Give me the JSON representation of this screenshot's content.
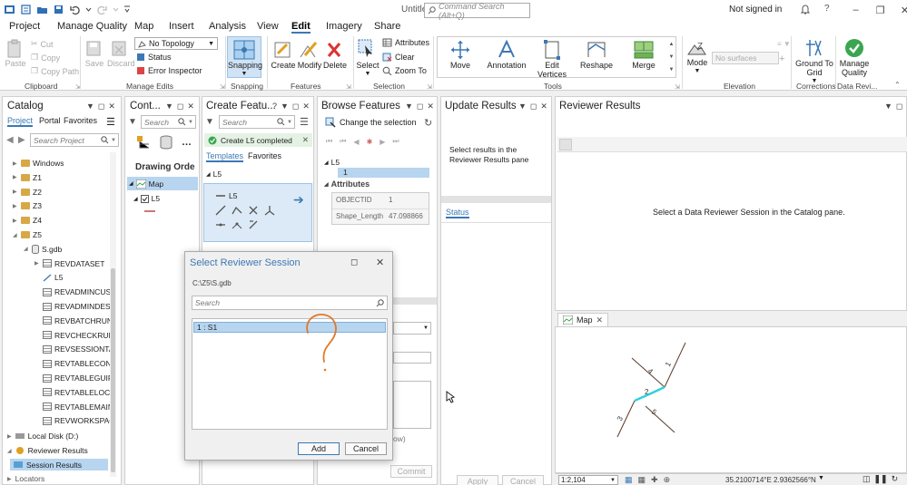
{
  "titlebar": {
    "doc_title": "Untitled",
    "command_search_placeholder": "Command Search (Alt+Q)",
    "signed_in": "Not signed in"
  },
  "menu": {
    "tabs": [
      "Project",
      "Manage Quality",
      "Map",
      "Insert",
      "Analysis",
      "View",
      "Edit",
      "Imagery",
      "Share"
    ],
    "active": "Edit"
  },
  "ribbon": {
    "clipboard": {
      "paste": "Paste",
      "cut": "Cut",
      "copy": "Copy",
      "copy_path": "Copy Path",
      "label": "Clipboard"
    },
    "manage_edits": {
      "save": "Save",
      "discard": "Discard",
      "topology": "No Topology",
      "status": "Status",
      "error_inspector": "Error Inspector",
      "label": "Manage Edits"
    },
    "snapping": {
      "snapping": "Snapping",
      "label": "Snapping"
    },
    "features": {
      "create": "Create",
      "modify": "Modify",
      "delete": "Delete",
      "label": "Features"
    },
    "selection": {
      "select": "Select",
      "attributes": "Attributes",
      "clear": "Clear",
      "zoom_to": "Zoom To",
      "label": "Selection"
    },
    "tools": {
      "move": "Move",
      "annotation": "Annotation",
      "edit_vertices": "Edit Vertices",
      "reshape": "Reshape",
      "merge": "Merge",
      "label": "Tools"
    },
    "elevation": {
      "mode": "Mode",
      "surfaces": "No surfaces",
      "label": "Elevation"
    },
    "corrections": {
      "ground_to_grid": "Ground To Grid",
      "label": "Corrections"
    },
    "data_reviewer": {
      "manage_quality": "Manage Quality",
      "label": "Data Revi..."
    }
  },
  "catalog": {
    "title": "Catalog",
    "tabs": [
      "Project",
      "Portal",
      "Favorites"
    ],
    "search_placeholder": "Search Project",
    "items": [
      {
        "label": "Windows",
        "type": "folder",
        "indent": 0
      },
      {
        "label": "Z1",
        "type": "folder",
        "indent": 0
      },
      {
        "label": "Z2",
        "type": "folder",
        "indent": 0
      },
      {
        "label": "Z3",
        "type": "folder",
        "indent": 0
      },
      {
        "label": "Z4",
        "type": "folder",
        "indent": 0
      },
      {
        "label": "Z5",
        "type": "folder",
        "indent": 0
      },
      {
        "label": "S.gdb",
        "type": "gdb",
        "indent": 1
      },
      {
        "label": "REVDATASET",
        "type": "dataset",
        "indent": 2
      },
      {
        "label": "L5",
        "type": "line",
        "indent": 2
      },
      {
        "label": "REVADMINCUST",
        "type": "table",
        "indent": 2
      },
      {
        "label": "REVADMINDESC",
        "type": "table",
        "indent": 2
      },
      {
        "label": "REVBATCHRUNT",
        "type": "table",
        "indent": 2
      },
      {
        "label": "REVCHECKRUNT",
        "type": "table",
        "indent": 2
      },
      {
        "label": "REVSESSIONTAE",
        "type": "table",
        "indent": 2
      },
      {
        "label": "REVTABLECONFI",
        "type": "table",
        "indent": 2
      },
      {
        "label": "REVTABLEGUIPR",
        "type": "table",
        "indent": 2
      },
      {
        "label": "REVTABLELOCAT",
        "type": "table",
        "indent": 2
      },
      {
        "label": "REVTABLEMAIN",
        "type": "table",
        "indent": 2
      },
      {
        "label": "REVWORKSPACE",
        "type": "table",
        "indent": 2
      }
    ],
    "bottom_items": [
      "Local Disk (D:)",
      "Reviewer Results",
      "Session Results",
      "Locators"
    ]
  },
  "contents": {
    "title": "Cont...",
    "search_placeholder": "Search",
    "drawing_order": "Drawing Orde",
    "map": "Map",
    "layer": "L5"
  },
  "create_features": {
    "title": "Create Featu...",
    "search_placeholder": "Search",
    "status": "Create L5 completed",
    "tabs": [
      "Templates",
      "Favorites"
    ],
    "group": "L5",
    "template": "L5"
  },
  "browse_features": {
    "title": "Browse Features",
    "change_selection": "Change the selection",
    "layer": "L5",
    "selected": "1",
    "attributes_label": "Attributes",
    "fields": [
      {
        "name": "OBJECTID",
        "value": "1"
      },
      {
        "name": "Shape_Length",
        "value": "47.098866"
      }
    ],
    "commit": "Commit",
    "partial_text": "ow)"
  },
  "update_results": {
    "title": "Update Results",
    "message": "Select results in the Reviewer Results pane",
    "status_tab": "Status",
    "apply": "Apply",
    "cancel": "Cancel"
  },
  "reviewer_results": {
    "title": "Reviewer Results",
    "message": "Select a Data Reviewer Session in the Catalog pane."
  },
  "map_view": {
    "tab": "Map",
    "scale": "1:2,104",
    "coords": "35.2100714°E 2.9362566°N"
  },
  "map_labels": [
    "1",
    "2",
    "3",
    "4",
    "5"
  ],
  "dialog": {
    "title": "Select Reviewer Session",
    "path": "C:\\Z5\\S.gdb",
    "search_placeholder": "Search",
    "session": "1 : S1",
    "add": "Add",
    "cancel": "Cancel"
  },
  "colors": {
    "accent": "#3c78b4",
    "highlight": "#b7d5ef",
    "annotation": "#e0782a",
    "selected_line": "#30d0e0",
    "ok_green": "#3aa650"
  }
}
